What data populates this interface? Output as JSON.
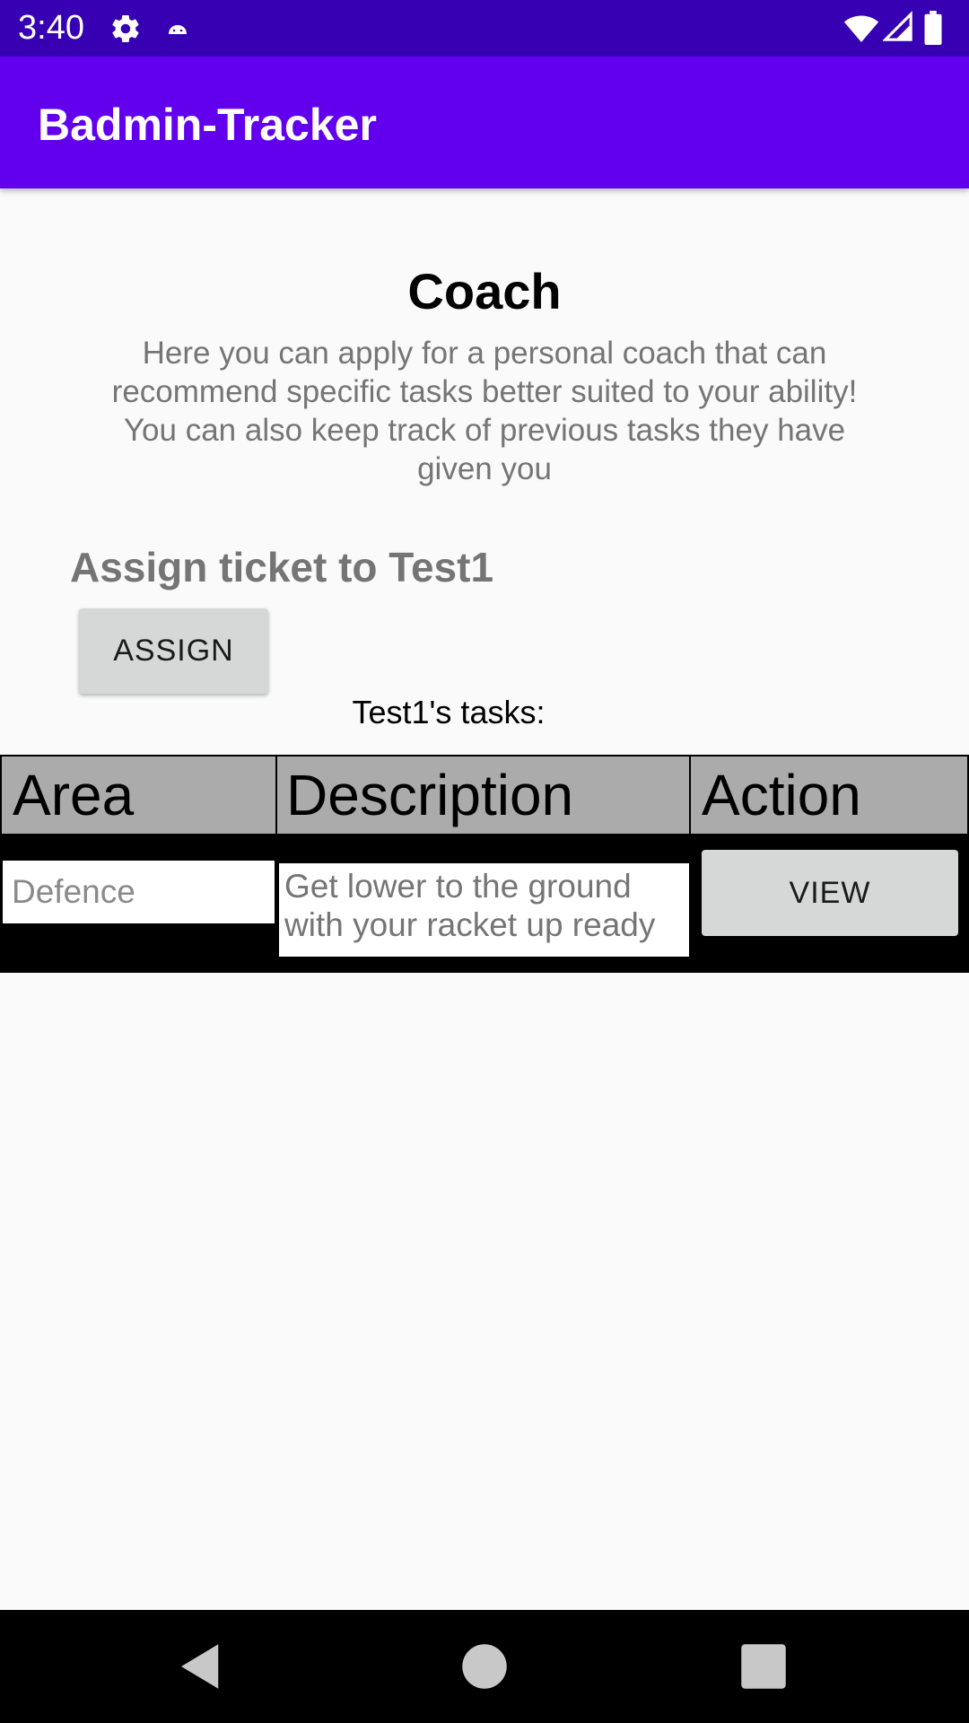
{
  "status_bar": {
    "time": "3:40",
    "icons": [
      "gear-icon",
      "android-icon",
      "wifi-icon",
      "signal-icon",
      "battery-icon"
    ]
  },
  "app_bar": {
    "title": "Badmin-Tracker"
  },
  "main": {
    "title": "Coach",
    "description": "Here you can apply for a personal coach that can recommend specific tasks better suited to your ability! You can also keep track of previous tasks they have given you",
    "assign_heading": "Assign ticket to Test1",
    "assign_button_label": "ASSIGN",
    "tasks_label": "Test1's tasks:"
  },
  "table": {
    "columns": [
      "Area",
      "Description",
      "Action"
    ],
    "rows": [
      {
        "area": "Defence",
        "description": "Get lower to the ground with your racket up ready",
        "action_label": "VIEW"
      }
    ]
  },
  "nav_bar": {
    "icons": [
      "back-icon",
      "home-icon",
      "recents-icon"
    ]
  },
  "colors": {
    "status_bar": "#3700b3",
    "app_bar": "#6200ee",
    "background": "#fafafa",
    "table_header": "#ababab",
    "button": "#d6d7d7"
  }
}
